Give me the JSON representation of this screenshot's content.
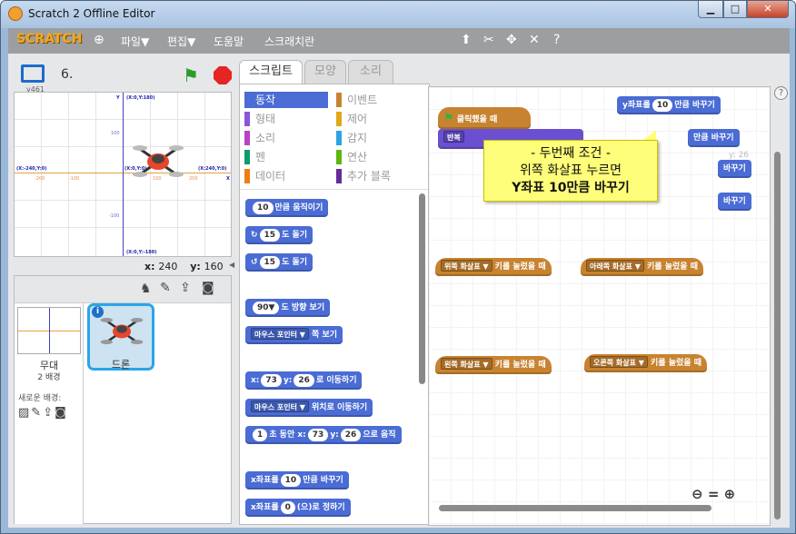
{
  "window": {
    "title": "Scratch 2 Offline Editor",
    "min": "▁",
    "max": "□",
    "close": "✕"
  },
  "menu": {
    "logo": "SCRATCH",
    "file": "파일▼",
    "edit": "편집▼",
    "help": "도움말",
    "about": "스크래치란"
  },
  "stage": {
    "name": "6.",
    "version": "v461",
    "mouse_x_label": "x:",
    "mouse_x": "240",
    "mouse_y_label": "y:",
    "mouse_y": "160",
    "coords": {
      "top": "(X:0,Y:180)",
      "left": "(X:-240,Y:0)",
      "right": "(X:240,Y:0)",
      "bottom": "(X:0,Y:-180)",
      "center": "(X:0,Y:0)",
      "x_label": "X",
      "y_label": "Y"
    },
    "ticks": {
      "x_neg2": "-200",
      "x_neg1": "-100",
      "x_pos1": "100",
      "x_pos2": "200",
      "y_pos1": "100",
      "y_neg1": "-100"
    }
  },
  "sprites": {
    "stage_label": "무대",
    "backdrop_count": "2 배경",
    "new_backdrop": "새로운 배경:",
    "sprite_name": "드론",
    "info": "i"
  },
  "tabs": {
    "scripts": "스크립트",
    "costumes": "모양",
    "sounds": "소리"
  },
  "categories": [
    {
      "label": "동작",
      "color": "#4a6cd4"
    },
    {
      "label": "이벤트",
      "color": "#c88330"
    },
    {
      "label": "형태",
      "color": "#8a55d7"
    },
    {
      "label": "제어",
      "color": "#e1a91a"
    },
    {
      "label": "소리",
      "color": "#bb42c3"
    },
    {
      "label": "감지",
      "color": "#2ca5e2"
    },
    {
      "label": "펜",
      "color": "#0e9a6c"
    },
    {
      "label": "연산",
      "color": "#5cb712"
    },
    {
      "label": "데이터",
      "color": "#ee7d16"
    },
    {
      "label": "추가 블록",
      "color": "#632d99"
    }
  ],
  "palette": {
    "move": {
      "val": "10",
      "text": "만큼 움직이기"
    },
    "turn_right": {
      "val": "15",
      "text": "도 돌기"
    },
    "turn_left": {
      "val": "15",
      "text": "도 돌기"
    },
    "point_dir": {
      "val": "90▼",
      "text": "도 방향 보기"
    },
    "point_towards": {
      "dd": "마우스 포인터 ▼",
      "text": "쪽 보기"
    },
    "goto_xy": {
      "x_label": "x:",
      "x": "73",
      "y_label": "y:",
      "y": "26",
      "text": "로 이동하기"
    },
    "goto": {
      "dd": "마우스 포인터 ▼",
      "text": "위치로 이동하기"
    },
    "glide": {
      "secs": "1",
      "pre": "초 동안 x:",
      "x": "73",
      "y_label": "y:",
      "y": "26",
      "text": "으로 움직"
    },
    "change_x": {
      "pre": "x좌표를",
      "val": "10",
      "text": "만큼 바꾸기"
    },
    "set_x": {
      "pre": "x좌표를",
      "val": "0",
      "text": "(으)로 정하기"
    }
  },
  "script": {
    "flag_hat": "클릭했을 때",
    "forever": "반복",
    "change_y": {
      "pre": "y좌표를",
      "val": "10",
      "text": "만큼 바꾸기"
    },
    "key_up": {
      "dd": "위쪽 화살표 ▼",
      "text": "키를 눌렀을 때"
    },
    "key_down": {
      "dd": "아래쪽 화살표 ▼",
      "text": "키를 눌렀을 때"
    },
    "key_left": {
      "dd": "왼쪽 화살표 ▼",
      "text": "키를 눌렀을 때"
    },
    "key_right": {
      "dd": "오른쪽 화살표 ▼",
      "text": "키를 눌렀을 때"
    },
    "change_y_2": "만큼 바꾸기",
    "change_y_3": "바꾸기",
    "change_y_4": "바꾸기",
    "pos_hint": "y: 26"
  },
  "callout": {
    "line1": "- 두번째 조건 -",
    "line2": "위쪽 화살표 누르면",
    "line3": "Y좌표 10만큼 바꾸기"
  },
  "zoom": {
    "out": "⊖",
    "reset": "=",
    "in": "⊕"
  },
  "help": "?"
}
